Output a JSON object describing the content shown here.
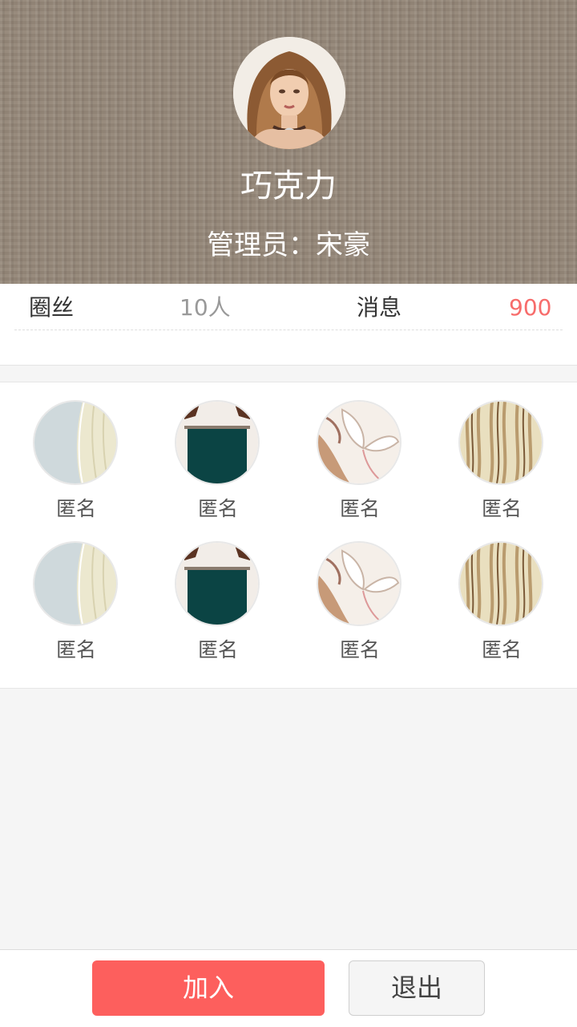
{
  "colors": {
    "header_bg": "#958779",
    "accent": "#fd5f5d",
    "message_count": "#f76c6b",
    "muted": "#999999"
  },
  "group": {
    "name": "巧克力",
    "admin": "管理员：宋豪",
    "avatar_icon": "group-avatar-photo"
  },
  "stats": {
    "members_label": "圈丝",
    "members_value": "10人",
    "messages_label": "消息",
    "messages_value": "900"
  },
  "members": [
    {
      "name": "匿名",
      "avatar": "hair-light"
    },
    {
      "name": "匿名",
      "avatar": "green-dress"
    },
    {
      "name": "匿名",
      "avatar": "flower"
    },
    {
      "name": "匿名",
      "avatar": "hair-blonde"
    },
    {
      "name": "匿名",
      "avatar": "hair-light"
    },
    {
      "name": "匿名",
      "avatar": "green-dress"
    },
    {
      "name": "匿名",
      "avatar": "flower"
    },
    {
      "name": "匿名",
      "avatar": "hair-blonde"
    }
  ],
  "actions": {
    "join_label": "加入",
    "exit_label": "退出"
  }
}
